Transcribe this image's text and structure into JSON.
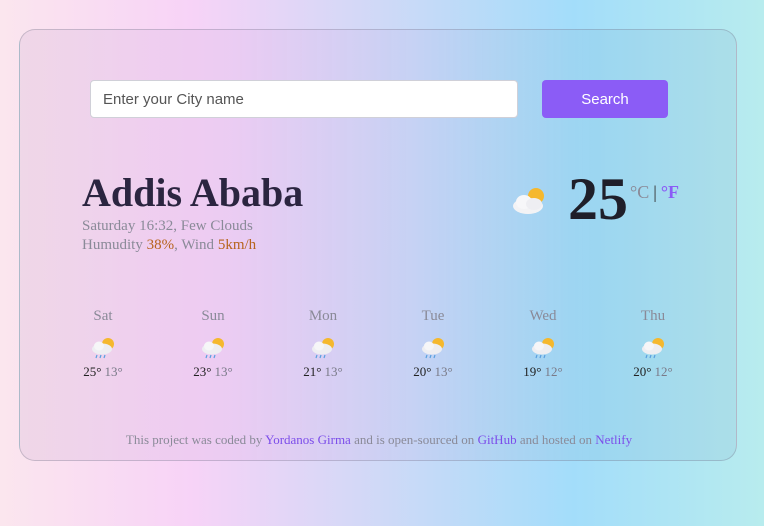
{
  "search": {
    "placeholder": "Enter your City name",
    "button_label": "Search"
  },
  "current": {
    "city": "Addis Ababa",
    "datetime": "Saturday 16:32",
    "separator": ", ",
    "description": "Few Clouds",
    "humidity_label": "Humudity ",
    "humidity_value": "38%",
    "wind_label": ", Wind ",
    "wind_value": "5km/h",
    "temperature": "25",
    "unit_c": "°C",
    "unit_sep": "|",
    "unit_f": "°F",
    "icon": "partly-cloudy-icon"
  },
  "forecast": [
    {
      "day": "Sat",
      "max": "25°",
      "min": "13°",
      "icon": "rain-cloud-sun-icon"
    },
    {
      "day": "Sun",
      "max": "23°",
      "min": "13°",
      "icon": "rain-cloud-sun-icon"
    },
    {
      "day": "Mon",
      "max": "21°",
      "min": "13°",
      "icon": "rain-cloud-sun-icon"
    },
    {
      "day": "Tue",
      "max": "20°",
      "min": "13°",
      "icon": "rain-cloud-sun-icon"
    },
    {
      "day": "Wed",
      "max": "19°",
      "min": "12°",
      "icon": "rain-cloud-sun-icon"
    },
    {
      "day": "Thu",
      "max": "20°",
      "min": "12°",
      "icon": "rain-cloud-sun-icon"
    }
  ],
  "footer": {
    "text1": "This project was coded by ",
    "author": "Yordanos Girma",
    "text2": " and is open-sourced on ",
    "github": "GitHub",
    "text3": " and hosted on ",
    "netlify": "Netlify"
  },
  "colors": {
    "accent": "#8b5cf6",
    "highlight": "#b7641d"
  }
}
